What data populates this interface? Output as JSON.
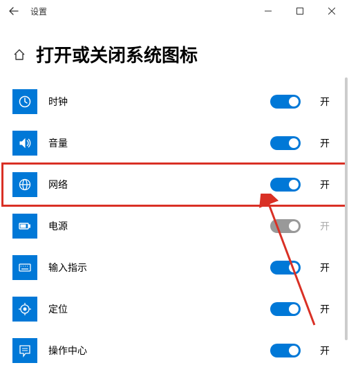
{
  "window": {
    "title": "设置"
  },
  "page": {
    "heading": "打开或关闭系统图标"
  },
  "items": [
    {
      "icon": "clock-icon",
      "label": "时钟",
      "state_label": "开",
      "on": true,
      "enabled": true,
      "highlighted": false
    },
    {
      "icon": "volume-icon",
      "label": "音量",
      "state_label": "开",
      "on": true,
      "enabled": true,
      "highlighted": false
    },
    {
      "icon": "network-icon",
      "label": "网络",
      "state_label": "开",
      "on": true,
      "enabled": true,
      "highlighted": true
    },
    {
      "icon": "power-icon",
      "label": "电源",
      "state_label": "开",
      "on": false,
      "enabled": false,
      "highlighted": false
    },
    {
      "icon": "input-indicator-icon",
      "label": "输入指示",
      "state_label": "开",
      "on": true,
      "enabled": true,
      "highlighted": false
    },
    {
      "icon": "location-icon",
      "label": "定位",
      "state_label": "开",
      "on": true,
      "enabled": true,
      "highlighted": false
    },
    {
      "icon": "action-center-icon",
      "label": "操作中心",
      "state_label": "开",
      "on": true,
      "enabled": true,
      "highlighted": false
    }
  ],
  "colors": {
    "accent": "#0078d7",
    "annotation": "#d93025"
  }
}
